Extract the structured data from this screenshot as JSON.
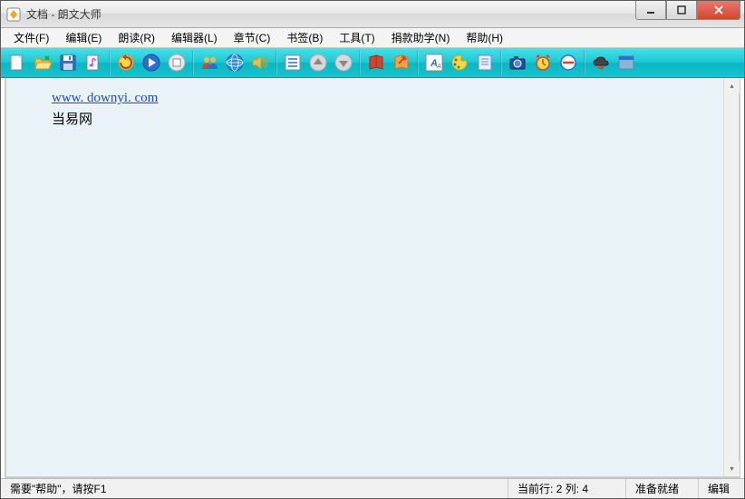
{
  "title": "文档 - 朗文大师",
  "menus": [
    "文件(F)",
    "编辑(E)",
    "朗读(R)",
    "编辑器(L)",
    "章节(C)",
    "书签(B)",
    "工具(T)",
    "捐款助学(N)",
    "帮助(H)"
  ],
  "toolbar_icons": [
    "new-icon",
    "open-icon",
    "save-icon",
    "music-icon",
    "sep",
    "refresh-icon",
    "play-icon",
    "stop-icon",
    "sep",
    "users-icon",
    "globe-icon",
    "speaker-icon",
    "sep",
    "list-icon",
    "up-icon",
    "down-icon",
    "sep",
    "book-red-icon",
    "book-orange-icon",
    "sep",
    "font-icon",
    "palette-icon",
    "note-icon",
    "sep",
    "camera-icon",
    "alarm-icon",
    "block-icon",
    "sep",
    "cloud-icon",
    "panel-icon"
  ],
  "content": {
    "link_text": "www. downyi. com",
    "line2": "当易网"
  },
  "status": {
    "help": "需要\"帮助\"，请按F1",
    "cursor": "当前行: 2 列: 4",
    "ready": "准备就绪",
    "mode": "编辑"
  }
}
